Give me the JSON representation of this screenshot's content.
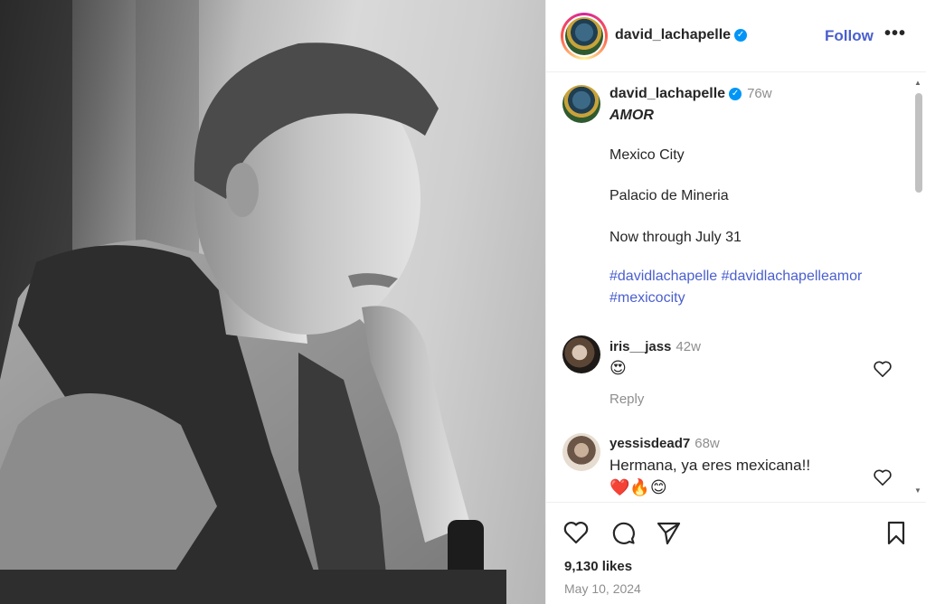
{
  "post": {
    "author": "david_lachapelle",
    "verified_icon": "verified-badge-icon",
    "follow_label": "Follow",
    "more_label": "•••"
  },
  "caption": {
    "author": "david_lachapelle",
    "time": "76w",
    "title": "AMOR",
    "line1": "Mexico City",
    "line2": "Palacio de Mineria",
    "line3": "Now through July 31",
    "hashtags": "#davidlachapelle #davidlachapelleamor #mexicocity"
  },
  "comments": [
    {
      "user": "iris__jass",
      "time": "42w",
      "text": "😍",
      "reply": "Reply"
    },
    {
      "user": "yessisdead7",
      "time": "68w",
      "text": "Hermana, ya eres mexicana!!",
      "emojis": "❤️🔥😊"
    }
  ],
  "actions": {
    "likes": "9,130 likes",
    "date": "May 10, 2024"
  },
  "colors": {
    "link": "#4a5fcf",
    "muted": "#8e8e8e",
    "verified": "#0095f6"
  }
}
